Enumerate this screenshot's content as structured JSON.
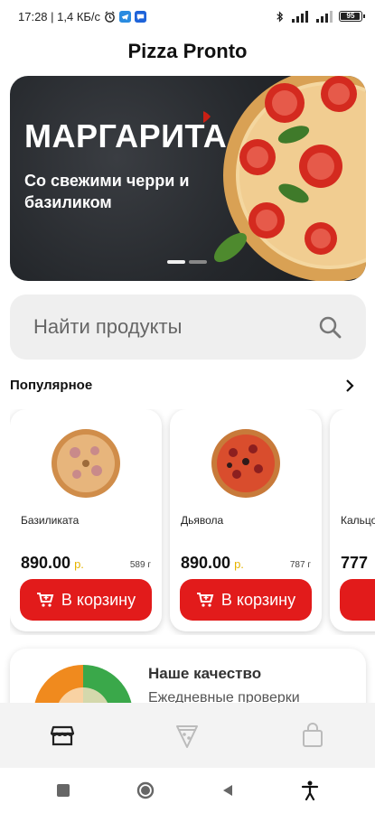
{
  "status_bar": {
    "time_speed": "17:28 | 1,4 КБ/с",
    "battery": "95",
    "battery_level": 0.95
  },
  "app": {
    "title": "Pizza Pronto"
  },
  "banner": {
    "title": "МАРГАРИТА",
    "subtitle": "Со свежими черри и базиликом",
    "slides": 2,
    "active_slide": 0
  },
  "search": {
    "placeholder": "Найти продукты"
  },
  "popular": {
    "title": "Популярное",
    "products": [
      {
        "name": "Базиликата",
        "price": "890.00",
        "currency": "р.",
        "weight": "589 г",
        "button": "В корзину"
      },
      {
        "name": "Дьявола",
        "price": "890.00",
        "currency": "р.",
        "weight": "787 г",
        "button": "В корзину"
      },
      {
        "name": "Кальцоне",
        "price": "777",
        "currency": "",
        "weight": "",
        "button": ""
      }
    ]
  },
  "quality": {
    "title": "Наше качество",
    "subtitle": "Ежедневные проверки"
  },
  "bottom_nav": {
    "items": [
      {
        "icon": "store-icon",
        "active": true
      },
      {
        "icon": "pizza-slice-icon",
        "active": false
      },
      {
        "icon": "shopping-bag-icon",
        "active": false
      }
    ]
  },
  "system_nav": {
    "items": [
      "recent-apps-icon",
      "home-icon",
      "back-icon",
      "accessibility-icon"
    ]
  },
  "colors": {
    "accent": "#e21b1b",
    "currency": "#e6b400",
    "banner_bg": "#24272b",
    "search_bg": "#efefef"
  }
}
